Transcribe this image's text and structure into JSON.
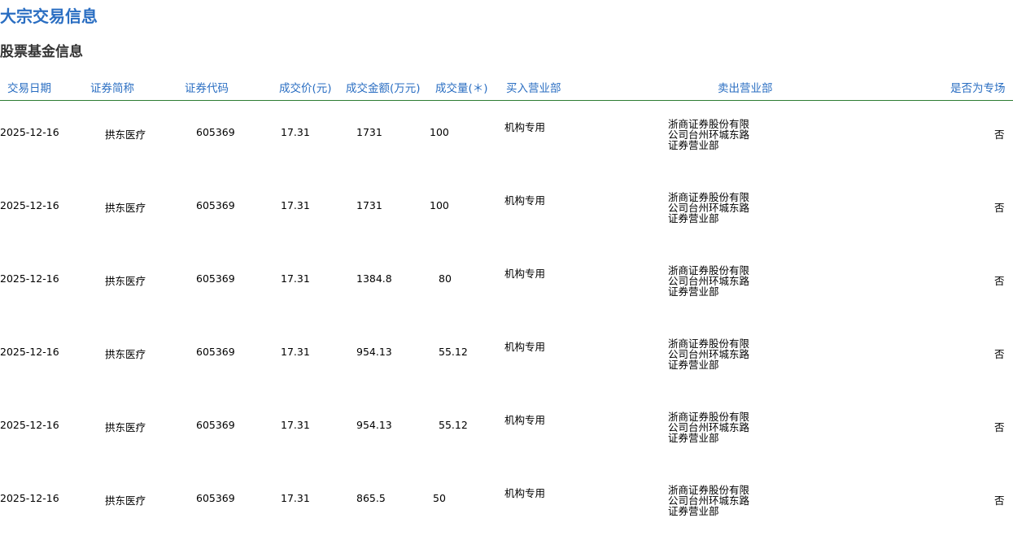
{
  "page": {
    "title": "大宗交易信息",
    "section_title": "股票基金信息"
  },
  "table": {
    "headers": {
      "date": "交易日期",
      "name": "证券简称",
      "code": "证券代码",
      "price": "成交价(元)",
      "amount": "成交金额(万元)",
      "volume": "成交量(＊)",
      "buyer": "买入营业部",
      "seller": "卖出营业部",
      "special": "是否为专场"
    },
    "rows": [
      {
        "date": "2025-12-16",
        "name": "拱东医疗",
        "code": "605369",
        "price": "17.31",
        "amount": "1731",
        "volume": "100",
        "buyer": "机构专用",
        "seller": "浙商证券股份有限公司台州环城东路证券营业部",
        "special": "否"
      },
      {
        "date": "2025-12-16",
        "name": "拱东医疗",
        "code": "605369",
        "price": "17.31",
        "amount": "1731",
        "volume": "100",
        "buyer": "机构专用",
        "seller": "浙商证券股份有限公司台州环城东路证券营业部",
        "special": "否"
      },
      {
        "date": "2025-12-16",
        "name": "拱东医疗",
        "code": "605369",
        "price": "17.31",
        "amount": "1384.8",
        "volume": "80",
        "buyer": "机构专用",
        "seller": "浙商证券股份有限公司台州环城东路证券营业部",
        "special": "否"
      },
      {
        "date": "2025-12-16",
        "name": "拱东医疗",
        "code": "605369",
        "price": "17.31",
        "amount": "954.13",
        "volume": "55.12",
        "buyer": "机构专用",
        "seller": "浙商证券股份有限公司台州环城东路证券营业部",
        "special": "否"
      },
      {
        "date": "2025-12-16",
        "name": "拱东医疗",
        "code": "605369",
        "price": "17.31",
        "amount": "954.13",
        "volume": "55.12",
        "buyer": "机构专用",
        "seller": "浙商证券股份有限公司台州环城东路证券营业部",
        "special": "否"
      },
      {
        "date": "2025-12-16",
        "name": "拱东医疗",
        "code": "605369",
        "price": "17.31",
        "amount": "865.5",
        "volume": "50",
        "buyer": "机构专用",
        "seller": "浙商证券股份有限公司台州环城东路证券营业部",
        "special": "否"
      }
    ]
  }
}
